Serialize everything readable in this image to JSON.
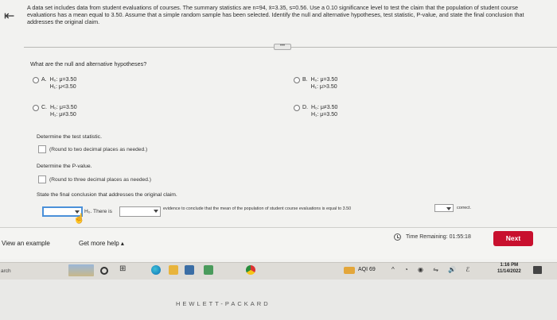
{
  "problem_text": "A data set includes data from student evaluations of courses. The summary statistics are n=94, x̄=3.35, s=0.56. Use a 0.10 significance level to test the claim that the population of student course evaluations has a mean equal to 3.50. Assume that a simple random sample has been selected. Identify the null and alternative hypotheses, test statistic, P-value, and state the final conclusion that addresses the original claim.",
  "question": "What are the null and alternative hypotheses?",
  "options": [
    {
      "letter": "A.",
      "h0": "H₀: μ=3.50",
      "h1": "H₁: μ<3.50"
    },
    {
      "letter": "B.",
      "h0": "H₀: μ=3.50",
      "h1": "H₁: μ>3.50"
    },
    {
      "letter": "C.",
      "h0": "H₀: μ=3.50",
      "h1": "H₁: μ≠3.50"
    },
    {
      "letter": "D.",
      "h0": "H₀: μ≠3.50",
      "h1": "H₁: μ=3.50"
    }
  ],
  "test_stat": {
    "label": "Determine the test statistic.",
    "note": "(Round to two decimal places as needed.)"
  },
  "pvalue": {
    "label": "Determine the P-value.",
    "note": "(Round to three decimal places as needed.)"
  },
  "conclusion": {
    "label": "State the final conclusion that addresses the original claim.",
    "h0_text": "H₀. There is",
    "evidence_text": "evidence to conclude that the mean of the population of student course evaluations is equal to 3.50",
    "trailing": "correct."
  },
  "bottom": {
    "view_example": "View an example",
    "get_help": "Get more help ▴",
    "time_remaining": "Time Remaining: 01:55:18",
    "next": "Next"
  },
  "taskbar": {
    "search_stub": "arch",
    "aqi": "AQI 69",
    "tray": "^ ◔ ◉ ⇋ 🔊 ℰ",
    "time": "1:16 PM",
    "date": "11/14/2022"
  },
  "brand": "HEWLETT-PACKARD",
  "icons": {
    "back": "back-arrow-icon",
    "clock": "clock-icon"
  }
}
